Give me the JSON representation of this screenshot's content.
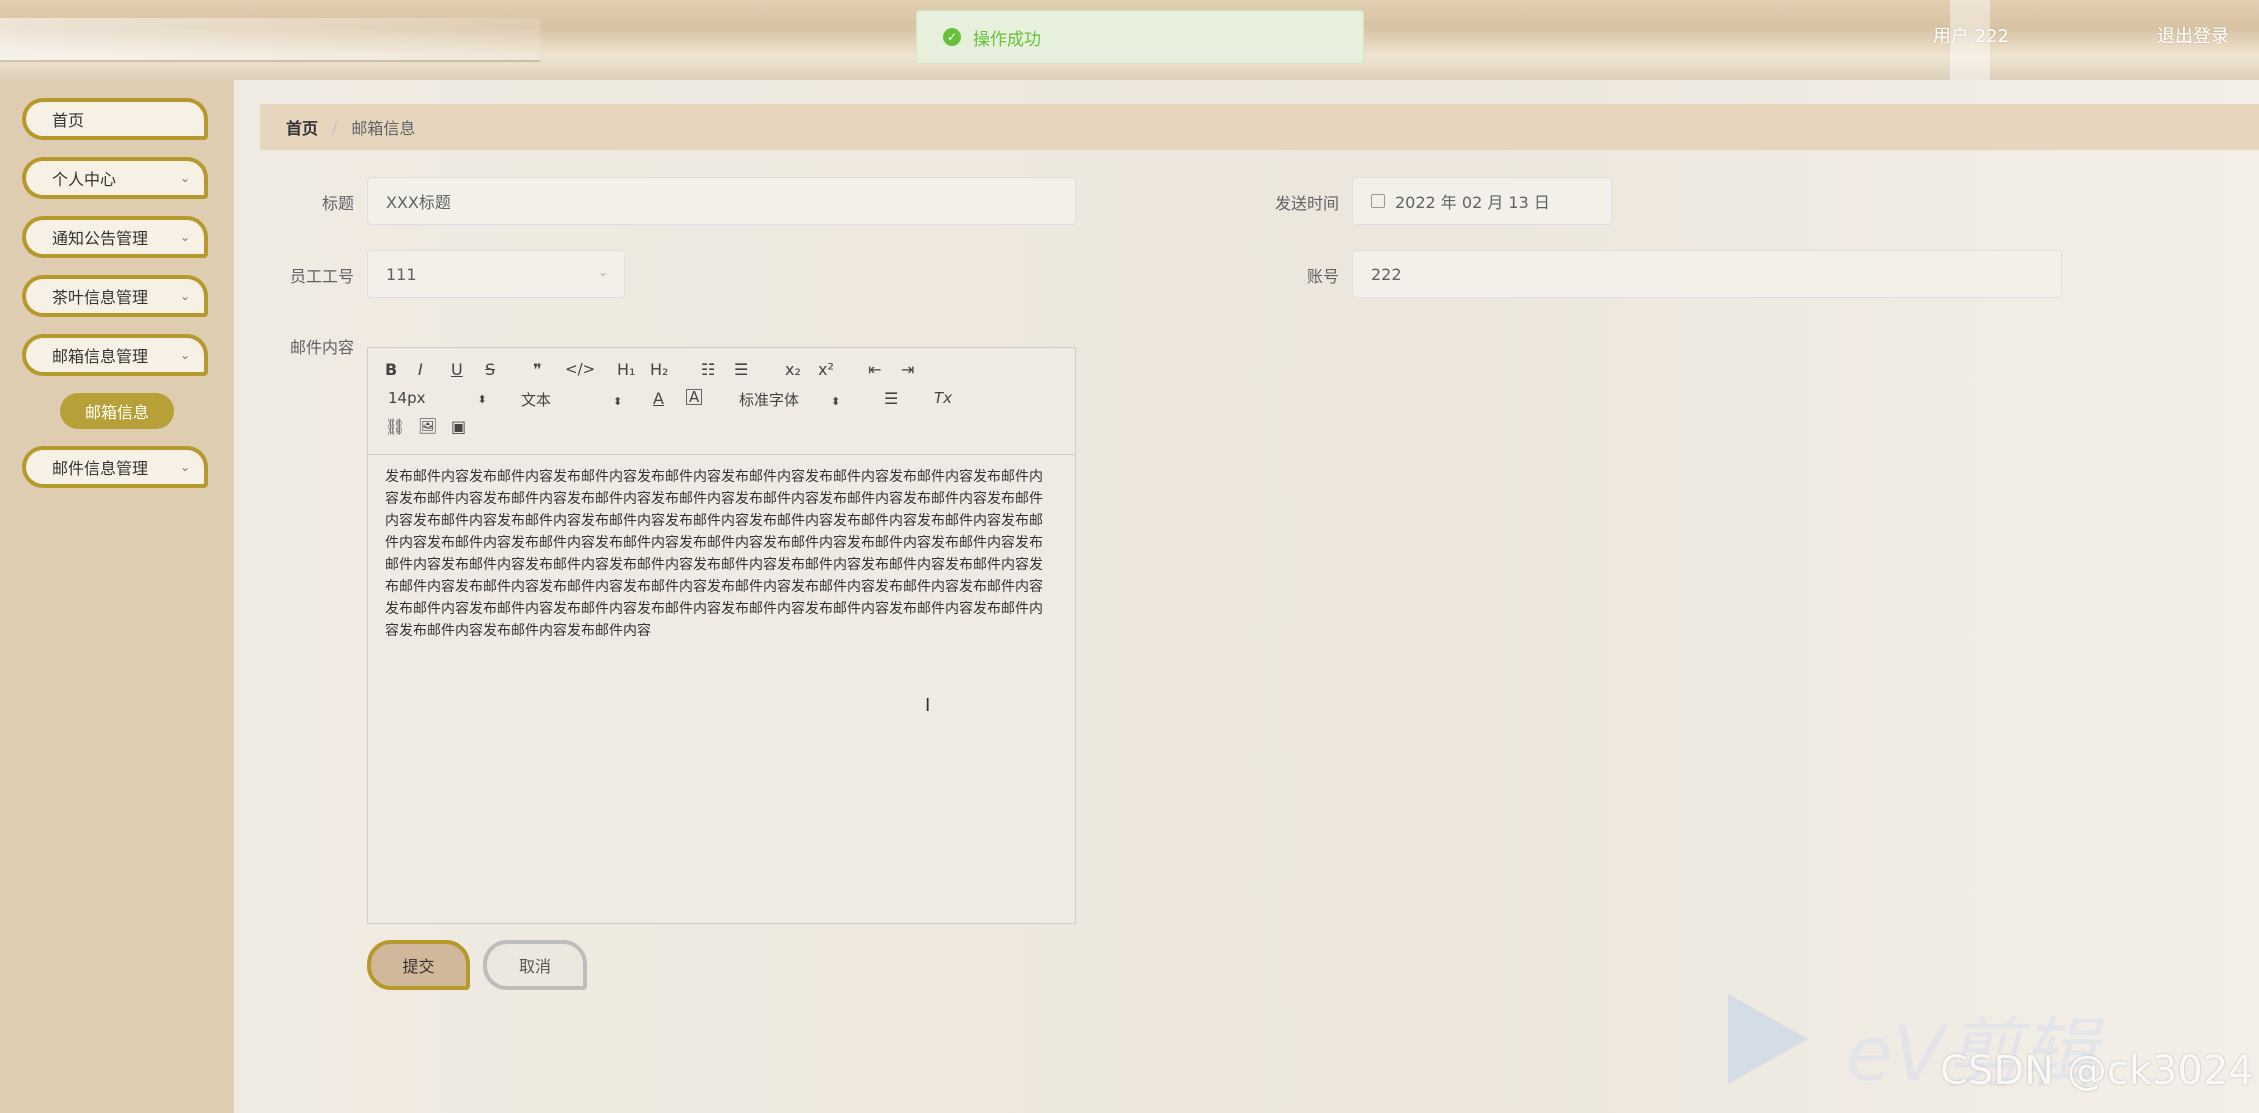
{
  "header": {
    "user_label": "用户 222",
    "logout_label": "退出登录"
  },
  "toast": {
    "icon": "check-circle-icon",
    "message": "操作成功",
    "color": "#67c23a"
  },
  "sidebar": {
    "items": [
      {
        "label": "首页"
      },
      {
        "label": "个人中心"
      },
      {
        "label": "通知公告管理"
      },
      {
        "label": "茶叶信息管理"
      },
      {
        "label": "邮箱信息管理"
      },
      {
        "label": "邮件信息管理"
      }
    ],
    "active_sub_item": "邮箱信息",
    "accent": "#b5992d"
  },
  "breadcrumb": {
    "home": "首页",
    "separator": "/",
    "current": "邮箱信息"
  },
  "form": {
    "title_label": "标题",
    "title_value": "XXX标题",
    "send_time_label": "发送时间",
    "send_time_value": "2022 年 02 月 13 日",
    "employee_no_label": "员工工号",
    "employee_no_value": "111",
    "account_label": "账号",
    "account_value": "222",
    "content_label": "邮件内容"
  },
  "editor": {
    "toolbar": {
      "bold": "B",
      "italic": "I",
      "underline": "U",
      "strike": "S",
      "quote": "❞",
      "code": "</>",
      "h1": "H₁",
      "h2": "H₂",
      "ordered": "☷",
      "bullet": "☰",
      "sub": "x₂",
      "sup": "x²",
      "outdent": "⇤",
      "indent": "⇥",
      "size": "14px",
      "header_picker": "文本",
      "font_picker": "标准字体",
      "color": "A",
      "background": "A",
      "align": "☰",
      "clean": "Tx",
      "link": "⛓",
      "image": "🖼",
      "video": "▣"
    },
    "content": "发布邮件内容发布邮件内容发布邮件内容发布邮件内容发布邮件内容发布邮件内容发布邮件内容发布邮件内容发布邮件内容发布邮件内容发布邮件内容发布邮件内容发布邮件内容发布邮件内容发布邮件内容发布邮件内容发布邮件内容发布邮件内容发布邮件内容发布邮件内容发布邮件内容发布邮件内容发布邮件内容发布邮件内容发布邮件内容发布邮件内容发布邮件内容发布邮件内容发布邮件内容发布邮件内容发布邮件内容发布邮件内容发布邮件内容发布邮件内容发布邮件内容发布邮件内容发布邮件内容发布邮件内容发布邮件内容发布邮件内容发布邮件内容发布邮件内容发布邮件内容发布邮件内容发布邮件内容发布邮件内容发布邮件内容发布邮件内容发布邮件内容发布邮件内容发布邮件内容发布邮件内容发布邮件内容发布邮件内容发布邮件内容发布邮件内容发布邮件内容发布邮件内容"
  },
  "actions": {
    "submit": "提交",
    "cancel": "取消"
  },
  "watermark": {
    "brand": "eV剪辑",
    "csdn": "CSDN @ck3024"
  }
}
